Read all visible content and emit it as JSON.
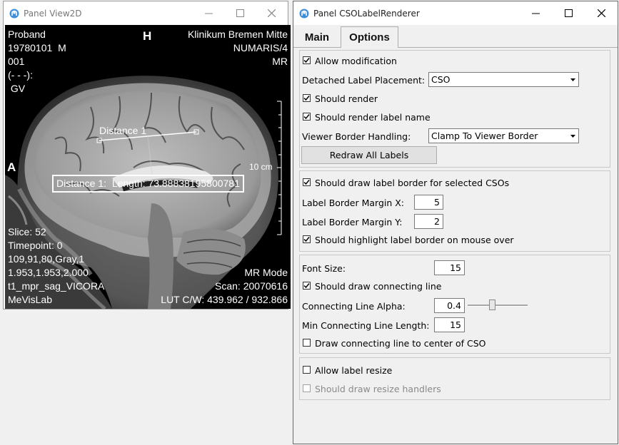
{
  "view2d": {
    "title": "Panel View2D",
    "top_left": [
      "Proband",
      "19780101  M",
      "001",
      "(- - -):",
      " GV"
    ],
    "top_center": "H",
    "top_right": [
      "Klinikum Bremen Mitte",
      "NUMARIS/4",
      "MR"
    ],
    "left_marker": "A",
    "scale_label": "10 cm",
    "distance_label": "Distance 1",
    "length_label": "Distance 1:  Length: 73.88838195800781",
    "bottom_left": [
      "Slice: 52",
      "Timepoint: 0",
      "109,91,80,Gray,1",
      "1.953,1.953,2.000",
      "t1_mpr_sag_VICORA",
      "MeVisLab"
    ],
    "bottom_right": [
      "MR Mode",
      "Scan: 20070616",
      "LUT C/W: 439.962 / 932.866"
    ]
  },
  "cso": {
    "title": "Panel CSOLabelRenderer",
    "tabs": [
      {
        "label": "Main",
        "selected": false
      },
      {
        "label": "Options",
        "selected": true
      }
    ],
    "allow_modification": {
      "label": "Allow modification",
      "checked": true
    },
    "detached_label_placement": {
      "label": "Detached Label Placement:",
      "value": "CSO"
    },
    "should_render": {
      "label": "Should render",
      "checked": true
    },
    "should_render_label_name": {
      "label": "Should render label name",
      "checked": true
    },
    "viewer_border_handling": {
      "label": "Viewer Border Handling:",
      "value": "Clamp To Viewer Border"
    },
    "redraw_button": "Redraw All Labels",
    "draw_label_border": {
      "label": "Should draw label border for selected CSOs",
      "checked": true
    },
    "margin_x": {
      "label": "Label Border Margin X:",
      "value": "5"
    },
    "margin_y": {
      "label": "Label Border Margin Y:",
      "value": "2"
    },
    "highlight_border": {
      "label": "Should highlight label border on mouse over",
      "checked": true
    },
    "font_size": {
      "label": "Font Size:",
      "value": "15"
    },
    "draw_connecting_line": {
      "label": "Should draw connecting line",
      "checked": true
    },
    "connecting_line_alpha": {
      "label": "Connecting Line Alpha:",
      "value": "0.4",
      "slider_fraction": 0.4
    },
    "min_connecting_line_length": {
      "label": "Min Connecting Line Length:",
      "value": "15"
    },
    "draw_to_center": {
      "label": "Draw connecting line to center of CSO",
      "checked": false
    },
    "allow_label_resize": {
      "label": "Allow label resize",
      "checked": false
    },
    "draw_resize_handlers": {
      "label": "Should draw resize handlers",
      "checked": false,
      "disabled": true
    }
  }
}
